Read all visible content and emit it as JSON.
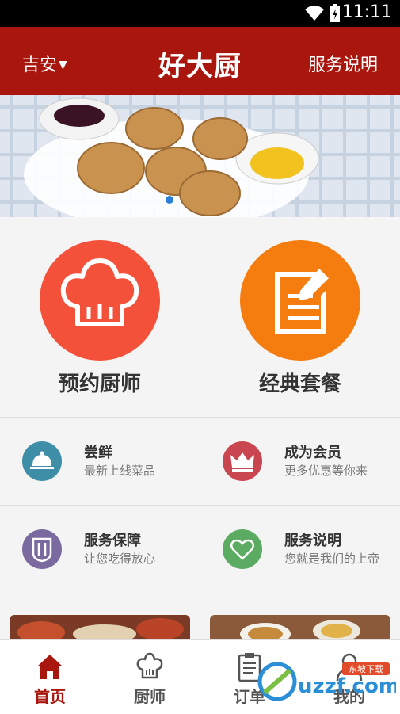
{
  "status_bar": {
    "time": "11:11"
  },
  "app_bar": {
    "city": "吉安",
    "title": "好大厨",
    "service_link": "服务说明"
  },
  "banner": {
    "active_slide_index": 0
  },
  "main_features": [
    {
      "label": "预约厨师",
      "icon": "chef-hat-icon",
      "color": "#f4513b"
    },
    {
      "label": "经典套餐",
      "icon": "notepad-pen-icon",
      "color": "#f57c0f"
    }
  ],
  "sub_features": [
    {
      "title": "尝鲜",
      "subtitle": "最新上线菜品",
      "icon": "cloche-icon",
      "color": "#3f8ea7"
    },
    {
      "title": "成为会员",
      "subtitle": "更多优惠等你来",
      "icon": "crown-icon",
      "color": "#c94650"
    },
    {
      "title": "服务保障",
      "subtitle": "让您吃得放心",
      "icon": "fork-knife-icon",
      "color": "#7b6aa0"
    },
    {
      "title": "服务说明",
      "subtitle": "您就是我们的上帝",
      "icon": "heart-icon",
      "color": "#5cab63"
    }
  ],
  "tabs": [
    {
      "label": "首页",
      "icon": "home-icon",
      "active": true
    },
    {
      "label": "厨师",
      "icon": "chef-hat-icon",
      "active": false
    },
    {
      "label": "订单",
      "icon": "clipboard-icon",
      "active": false
    },
    {
      "label": "我的",
      "icon": "user-icon",
      "active": false
    }
  ],
  "watermark": {
    "text": "uzzf.com",
    "tag": "东坡下载"
  },
  "colors": {
    "brand": "#a8160e",
    "tab_active": "#a8160e",
    "tab_inactive": "#555555"
  }
}
